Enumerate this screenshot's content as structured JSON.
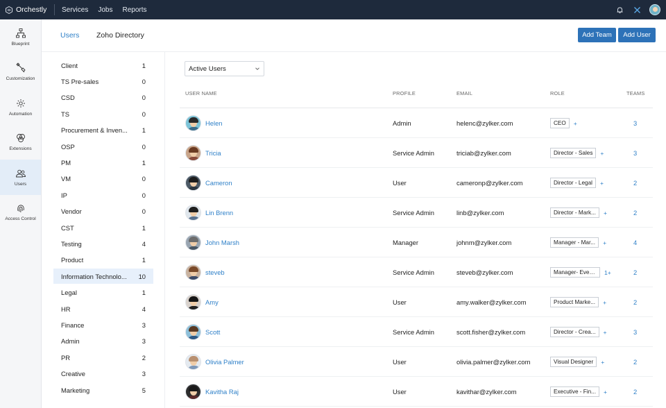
{
  "app": {
    "name": "Orchestly"
  },
  "topnav": {
    "items": [
      "Services",
      "Jobs",
      "Reports"
    ]
  },
  "rail": [
    {
      "label": "Blueprint",
      "icon": "blueprint-icon",
      "active": false
    },
    {
      "label": "Customization",
      "icon": "customization-icon",
      "active": false
    },
    {
      "label": "Automation",
      "icon": "automation-icon",
      "active": false
    },
    {
      "label": "Extensions",
      "icon": "extensions-icon",
      "active": false
    },
    {
      "label": "Users",
      "icon": "users-icon",
      "active": true
    },
    {
      "label": "Access Control",
      "icon": "fingerprint-icon",
      "active": false
    }
  ],
  "header": {
    "tabs": [
      {
        "label": "Users",
        "active": true
      },
      {
        "label": "Zoho Directory",
        "active": false
      }
    ],
    "add_team": "Add Team",
    "add_user": "Add User"
  },
  "teams": [
    {
      "name": "Client",
      "count": "1"
    },
    {
      "name": "TS Pre-sales",
      "count": "0"
    },
    {
      "name": "CSD",
      "count": "0"
    },
    {
      "name": "TS",
      "count": "0"
    },
    {
      "name": "Procurement & Inven...",
      "count": "1"
    },
    {
      "name": "OSP",
      "count": "0"
    },
    {
      "name": "PM",
      "count": "1"
    },
    {
      "name": "VM",
      "count": "0"
    },
    {
      "name": "IP",
      "count": "0"
    },
    {
      "name": "Vendor",
      "count": "0"
    },
    {
      "name": "CST",
      "count": "1"
    },
    {
      "name": "Testing",
      "count": "4"
    },
    {
      "name": "Product",
      "count": "1"
    },
    {
      "name": "Information Technolo...",
      "count": "10",
      "active": true
    },
    {
      "name": "Legal",
      "count": "1"
    },
    {
      "name": "HR",
      "count": "4"
    },
    {
      "name": "Finance",
      "count": "3"
    },
    {
      "name": "Admin",
      "count": "3"
    },
    {
      "name": "PR",
      "count": "2"
    },
    {
      "name": "Creative",
      "count": "3"
    },
    {
      "name": "Marketing",
      "count": "5"
    }
  ],
  "filter": {
    "selected": "Active Users"
  },
  "table": {
    "columns": {
      "user": "USER NAME",
      "profile": "PROFILE",
      "email": "EMAIL",
      "role": "ROLE",
      "teams": "TEAMS"
    },
    "rows": [
      {
        "name": "Helen",
        "profile": "Admin",
        "email": "helenc@zylker.com",
        "role": "CEO",
        "role_extra": "+",
        "teams": "3",
        "hair": "#2a2a2a",
        "bg": "#7cc4d8",
        "shirt": "#3b6d8a"
      },
      {
        "name": "Tricia",
        "profile": "Service Admin",
        "email": "triciab@zylker.com",
        "role": "Director - Sales",
        "role_extra": "+",
        "teams": "3",
        "hair": "#6b3b22",
        "bg": "#c9a58a",
        "shirt": "#8a4a3a"
      },
      {
        "name": "Cameron",
        "profile": "User",
        "email": "cameronp@zylker.com",
        "role": "Director - Legal",
        "role_extra": "+",
        "teams": "2",
        "hair": "#1d1d1d",
        "bg": "#4d5a66",
        "shirt": "#2c3640"
      },
      {
        "name": "Lin Brenn",
        "profile": "Service Admin",
        "email": "linb@zylker.com",
        "role": "Director - Mark...",
        "role_extra": "+",
        "teams": "2",
        "hair": "#1f1f1f",
        "bg": "#dfe6ec",
        "shirt": "#5a7390"
      },
      {
        "name": "John Marsh",
        "profile": "Manager",
        "email": "johnm@zylker.com",
        "role": "Manager - Mar...",
        "role_extra": "+",
        "teams": "4",
        "hair": "#6d6d6d",
        "bg": "#9aa6b2",
        "shirt": "#4a5866"
      },
      {
        "name": "steveb",
        "profile": "Service Admin",
        "email": "steveb@zylker.com",
        "role": "Manager- Events",
        "role_extra": "1+",
        "teams": "2",
        "hair": "#7a4a2a",
        "bg": "#c9b3a0",
        "shirt": "#3d4c6a"
      },
      {
        "name": "Amy",
        "profile": "User",
        "email": "amy.walker@zylker.com",
        "role": "Product Marke...",
        "role_extra": "+",
        "teams": "2",
        "hair": "#161616",
        "bg": "#d9d2cc",
        "shirt": "#222222"
      },
      {
        "name": "Scott",
        "profile": "Service Admin",
        "email": "scott.fisher@zylker.com",
        "role": "Director - Crea...",
        "role_extra": "+",
        "teams": "3",
        "hair": "#5a3a24",
        "bg": "#8ec0da",
        "shirt": "#2e5a86"
      },
      {
        "name": "Olivia Palmer",
        "profile": "User",
        "email": "olivia.palmer@zylker.com",
        "role": "Visual Designer",
        "role_extra": "+",
        "teams": "2",
        "hair": "#b89070",
        "bg": "#e4eaf0",
        "shirt": "#7e98b8"
      },
      {
        "name": "Kavitha Raj",
        "profile": "User",
        "email": "kavithar@zylker.com",
        "role": "Executive - Fin...",
        "role_extra": "+",
        "teams": "2",
        "hair": "#1a1a1a",
        "bg": "#2d2d2d",
        "shirt": "#5a2a2a"
      }
    ]
  }
}
